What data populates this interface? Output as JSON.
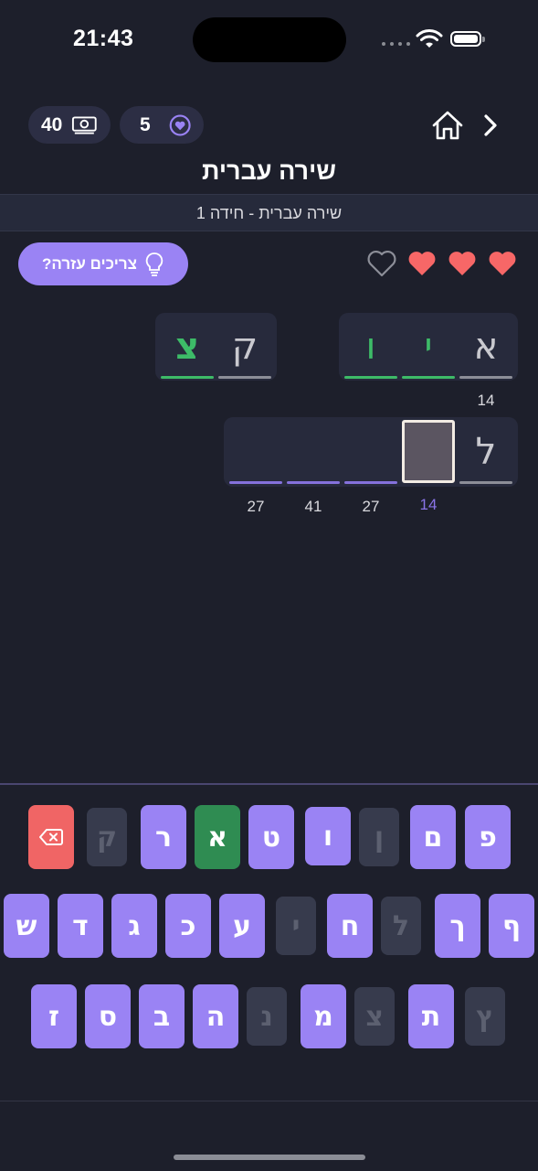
{
  "status": {
    "time": "21:43"
  },
  "top": {
    "coins": "40",
    "lives": "5"
  },
  "title": "שירה עברית",
  "subtitle": "שירה עברית - חידה 1",
  "help_label": "צריכים עזרה?",
  "hearts": {
    "filled": 3,
    "total": 4
  },
  "colors": {
    "accent": "#9a83f4",
    "correct": "#3dbb68",
    "heart": "#f76767",
    "delete": "#f06565",
    "background": "#1d1f2b"
  },
  "words": [
    {
      "cells": [
        {
          "letter": "א",
          "state": "given"
        },
        {
          "letter": "י",
          "state": "correct"
        },
        {
          "letter": "ו",
          "state": "correct"
        }
      ],
      "number": "14"
    },
    {
      "cells": [
        {
          "letter": "ק",
          "state": "given"
        },
        {
          "letter": "צ",
          "state": "correct"
        }
      ]
    },
    {
      "cells": [
        {
          "letter": "ל",
          "state": "given"
        },
        {
          "letter": "",
          "state": "cursor",
          "number": "14"
        },
        {
          "letter": "",
          "state": "empty",
          "number": "27"
        },
        {
          "letter": "",
          "state": "empty",
          "number": "41"
        },
        {
          "letter": "",
          "state": "empty",
          "number": "27"
        }
      ]
    }
  ],
  "keyboard": {
    "row1": [
      {
        "k": "פ",
        "s": "on"
      },
      {
        "k": "ם",
        "s": "on"
      },
      {
        "k": "ן",
        "s": "off"
      },
      {
        "k": "ו",
        "s": "on"
      },
      {
        "k": "ט",
        "s": "on"
      },
      {
        "k": "א",
        "s": "green"
      },
      {
        "k": "ר",
        "s": "on"
      },
      {
        "k": "ק",
        "s": "off"
      },
      {
        "k": "delete",
        "s": "del"
      }
    ],
    "row2": [
      {
        "k": "ף",
        "s": "on"
      },
      {
        "k": "ך",
        "s": "on"
      },
      {
        "k": "ל",
        "s": "off"
      },
      {
        "k": "ח",
        "s": "on"
      },
      {
        "k": "י",
        "s": "off"
      },
      {
        "k": "ע",
        "s": "on"
      },
      {
        "k": "כ",
        "s": "on"
      },
      {
        "k": "ג",
        "s": "on"
      },
      {
        "k": "ד",
        "s": "on"
      },
      {
        "k": "ש",
        "s": "on"
      }
    ],
    "row3": [
      {
        "k": "ץ",
        "s": "off"
      },
      {
        "k": "ת",
        "s": "on"
      },
      {
        "k": "צ",
        "s": "off"
      },
      {
        "k": "מ",
        "s": "on"
      },
      {
        "k": "נ",
        "s": "off"
      },
      {
        "k": "ה",
        "s": "on"
      },
      {
        "k": "ב",
        "s": "on"
      },
      {
        "k": "ס",
        "s": "on"
      },
      {
        "k": "ז",
        "s": "on"
      }
    ]
  }
}
